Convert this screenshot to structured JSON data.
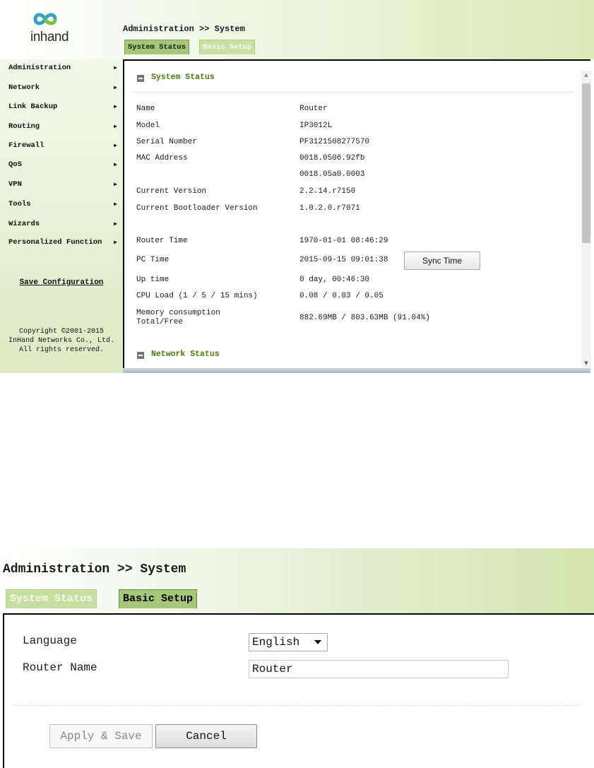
{
  "screen1": {
    "logo": {
      "text": "inhand"
    },
    "breadcrumb": "Administration >> System",
    "tabs": [
      {
        "label": "System Status",
        "active": true
      },
      {
        "label": "Basic Setup",
        "active": false
      }
    ],
    "sidebar": {
      "items": [
        {
          "label": "Administration"
        },
        {
          "label": "Network"
        },
        {
          "label": "Link Backup"
        },
        {
          "label": "Routing"
        },
        {
          "label": "Firewall"
        },
        {
          "label": "QoS"
        },
        {
          "label": "VPN"
        },
        {
          "label": "Tools"
        },
        {
          "label": "Wizards"
        },
        {
          "label": "Personalized Function"
        }
      ],
      "save_label": "Save Configuration",
      "copyright": [
        "Copyright ©2001-2015",
        "InHand Networks Co., Ltd.",
        "All rights reserved."
      ]
    },
    "system_status": {
      "title": "System Status",
      "rows": [
        {
          "label": "Name",
          "value": "Router"
        },
        {
          "label": "Model",
          "value": "IP3012L"
        },
        {
          "label": "Serial Number",
          "value": "PF3121508277570"
        },
        {
          "label": "MAC Address",
          "value": "0018.0506.92fb"
        },
        {
          "label": "",
          "value": "0018.05a0.0003"
        },
        {
          "label": "Current Version",
          "value": "2.2.14.r7150"
        },
        {
          "label": "Current Bootloader Version",
          "value": "1.0.2.0.r7071"
        },
        {
          "label": "Router Time",
          "value": "1970-01-01 08:46:29"
        },
        {
          "label": "PC Time",
          "value": "2015-09-15 09:01:38"
        },
        {
          "label": "Up time",
          "value": "0 day, 00:46:30"
        },
        {
          "label": "CPU Load (1 / 5 / 15 mins)",
          "value": "0.08 / 0.03 / 0.05"
        },
        {
          "label": "Memory consumption Total/Free",
          "value": "882.69MB / 803.63MB (91.04%)"
        }
      ],
      "sync_button": "Sync Time"
    },
    "network_status": {
      "title": "Network Status"
    }
  },
  "screen2": {
    "breadcrumb": "Administration >> System",
    "tabs": [
      {
        "label": "System Status",
        "active": false
      },
      {
        "label": "Basic Setup",
        "active": true
      }
    ],
    "form": {
      "language_label": "Language",
      "language_value": "English",
      "router_name_label": "Router Name",
      "router_name_value": "Router"
    },
    "buttons": {
      "apply": "Apply & Save",
      "cancel": "Cancel"
    }
  },
  "colors": {
    "accent_green": "#a6c779",
    "section_title_green": "#4a7a10",
    "header_gradient_end": "#d9e9b9"
  }
}
